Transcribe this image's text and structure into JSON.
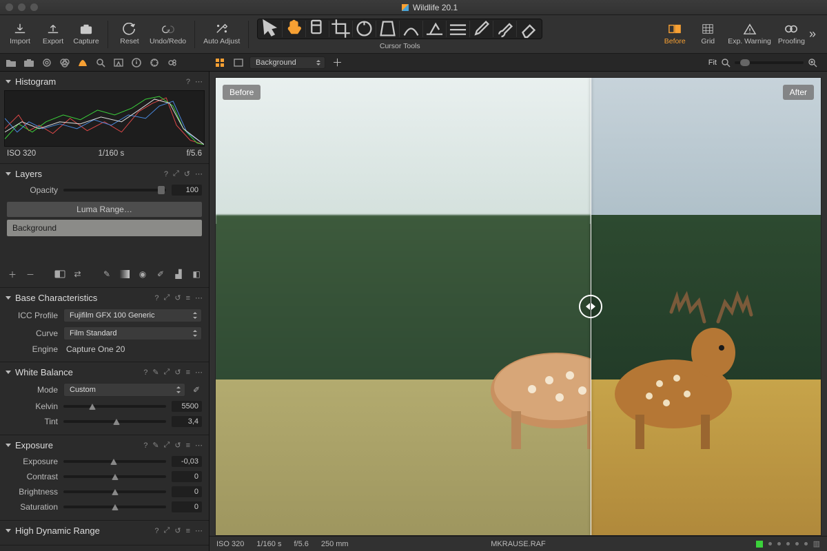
{
  "window": {
    "title": "Wildlife 20.1"
  },
  "toolbar": {
    "import": "Import",
    "export": "Export",
    "capture": "Capture",
    "reset": "Reset",
    "undoredo": "Undo/Redo",
    "autoadjust": "Auto Adjust",
    "cursor_tools_label": "Cursor Tools",
    "before": "Before",
    "grid": "Grid",
    "exp_warning": "Exp. Warning",
    "proofing": "Proofing"
  },
  "viewer_tabs": {
    "layer_selected": "Background",
    "zoom_label": "Fit"
  },
  "histogram": {
    "title": "Histogram",
    "iso": "ISO 320",
    "shutter": "1/160 s",
    "aperture": "f/5.6"
  },
  "layers": {
    "title": "Layers",
    "opacity_label": "Opacity",
    "opacity_value": "100",
    "luma_range": "Luma Range…",
    "item_background": "Background"
  },
  "base_char": {
    "title": "Base Characteristics",
    "icc_label": "ICC Profile",
    "icc_value": "Fujifilm GFX 100 Generic",
    "curve_label": "Curve",
    "curve_value": "Film Standard",
    "engine_label": "Engine",
    "engine_value": "Capture One 20"
  },
  "white_balance": {
    "title": "White Balance",
    "mode_label": "Mode",
    "mode_value": "Custom",
    "kelvin_label": "Kelvin",
    "kelvin_value": "5500",
    "tint_label": "Tint",
    "tint_value": "3,4"
  },
  "exposure": {
    "title": "Exposure",
    "exposure_label": "Exposure",
    "exposure_value": "-0,03",
    "contrast_label": "Contrast",
    "contrast_value": "0",
    "brightness_label": "Brightness",
    "brightness_value": "0",
    "saturation_label": "Saturation",
    "saturation_value": "0"
  },
  "hdr": {
    "title": "High Dynamic Range"
  },
  "compare": {
    "before_badge": "Before",
    "after_badge": "After"
  },
  "statusbar": {
    "iso": "ISO 320",
    "shutter": "1/160 s",
    "aperture": "f/5.6",
    "focal": "250 mm",
    "filename": "MKRAUSE.RAF"
  }
}
